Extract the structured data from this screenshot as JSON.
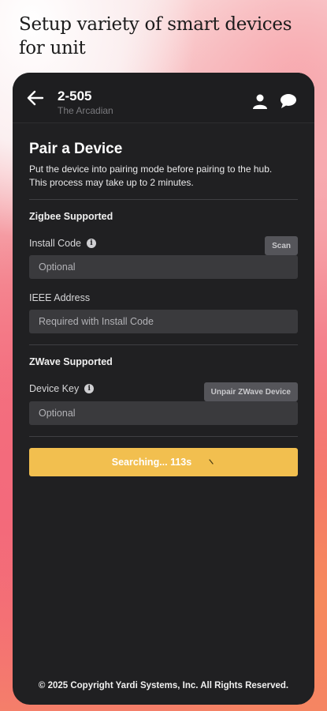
{
  "headline": {
    "line1": "Setup variety of smart devices",
    "line2": "for unit"
  },
  "topbar": {
    "unit_number": "2-505",
    "property_name": "The Arcadian",
    "icons": [
      "arrow-left-icon",
      "user-icon",
      "chat-icon"
    ]
  },
  "page": {
    "title": "Pair a Device",
    "description": "Put the device into pairing mode before pairing to the hub. This process may take up to 2 minutes."
  },
  "zigbee": {
    "section_title": "Zigbee Supported",
    "install_code_label": "Install Code",
    "install_code_placeholder": "Optional",
    "scan_label": "Scan",
    "ieee_label": "IEEE Address",
    "ieee_placeholder": "Required with Install Code"
  },
  "zwave": {
    "section_title": "ZWave Supported",
    "device_key_label": "Device Key",
    "device_key_placeholder": "Optional",
    "unpair_label": "Unpair ZWave Device"
  },
  "search": {
    "label": "Searching... 113s"
  },
  "footer": {
    "copyright": "© 2025 Copyright Yardi Systems, Inc. All Rights Reserved."
  },
  "colors": {
    "accent": "#f2bf4f",
    "panel": "#202022",
    "input": "#3a3a3d"
  }
}
